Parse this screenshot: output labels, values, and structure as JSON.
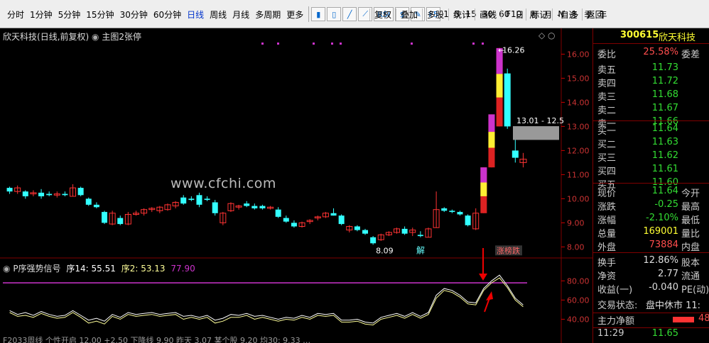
{
  "toolbar": {
    "periods": [
      "分时",
      "1分钟",
      "5分钟",
      "15分钟",
      "30分钟",
      "60分钟",
      "日线",
      "周线",
      "月线",
      "多周期",
      "更多"
    ],
    "active_period": "日线",
    "icons": [
      "kline-icon",
      "bar-icon",
      "line-icon",
      "trend-icon",
      "chart-icon",
      "pencil-icon",
      "f5-icon",
      "refresh-icon"
    ],
    "icon_glyphs": [
      "▮",
      "▯",
      "╱",
      "⟋",
      "RSI",
      "$",
      "✎",
      "F5"
    ],
    "period_numbers": [
      "1",
      "5",
      "15",
      "30",
      "60"
    ],
    "period_words": [
      "日",
      "周",
      "月",
      "N",
      "多",
      "季",
      "年"
    ],
    "right_buttons": [
      "复权",
      "叠加",
      "多股",
      "统计",
      "画线",
      "F10",
      "标记",
      "-自选",
      "返回"
    ]
  },
  "chart": {
    "title": "欣天科技",
    "title_paren": "(日线,前复权)",
    "template": "主图2张停",
    "high_label": "16.26",
    "low_label": "8.09",
    "range_label": "13.01 - 12.5",
    "tag_jie": "解",
    "tag_zt": "涨榜跌",
    "watermark": "www.cfchi.com",
    "price_ticks": [
      "16.00",
      "15.00",
      "14.00",
      "13.00",
      "12.00",
      "11.00",
      "10.00",
      "9.00",
      "8.00"
    ],
    "ind_ticks": [
      "80.00",
      "60.00",
      "40.00"
    ],
    "indicator": {
      "name": "P序强势信号",
      "s1_label": "序14: 55.51",
      "s2_label": "序2: 53.13",
      "s3_label": "77.90"
    },
    "bottom_bar": "F2033周线 个性开启 12.00 +2.50 下降线 9.90 昨天 3.07 某个股 9.20 均30: 9.33 …",
    "colors": {
      "up": "#ff3333",
      "down": "#33ffff",
      "ind_line1": "#ffffff",
      "ind_line2": "#ffff99",
      "threshold": "#cc33cc"
    }
  },
  "chart_data": [
    {
      "type": "candlestick",
      "title": "欣天科技 (日线,前复权)",
      "ylim": [
        7.6,
        16.6
      ],
      "candles": [
        {
          "o": 10.45,
          "h": 10.5,
          "l": 10.2,
          "c": 10.3
        },
        {
          "o": 10.3,
          "h": 10.55,
          "l": 10.2,
          "c": 10.45
        },
        {
          "o": 10.3,
          "h": 10.35,
          "l": 10.0,
          "c": 10.1
        },
        {
          "o": 10.2,
          "h": 10.35,
          "l": 10.1,
          "c": 10.25
        },
        {
          "o": 10.25,
          "h": 10.4,
          "l": 10.0,
          "c": 10.1
        },
        {
          "o": 10.2,
          "h": 10.3,
          "l": 10.1,
          "c": 10.15
        },
        {
          "o": 10.15,
          "h": 10.3,
          "l": 10.05,
          "c": 10.2
        },
        {
          "o": 10.2,
          "h": 10.3,
          "l": 10.1,
          "c": 10.15
        },
        {
          "o": 10.1,
          "h": 10.6,
          "l": 10.1,
          "c": 10.45
        },
        {
          "o": 10.45,
          "h": 10.5,
          "l": 10.1,
          "c": 10.15
        },
        {
          "o": 10.0,
          "h": 10.05,
          "l": 9.7,
          "c": 9.75
        },
        {
          "o": 9.75,
          "h": 9.85,
          "l": 9.6,
          "c": 9.65
        },
        {
          "o": 9.45,
          "h": 9.5,
          "l": 8.95,
          "c": 9.0
        },
        {
          "o": 8.95,
          "h": 9.5,
          "l": 8.9,
          "c": 9.4
        },
        {
          "o": 9.2,
          "h": 9.3,
          "l": 8.9,
          "c": 8.95
        },
        {
          "o": 8.95,
          "h": 9.45,
          "l": 8.9,
          "c": 9.35
        },
        {
          "o": 9.35,
          "h": 9.5,
          "l": 9.3,
          "c": 9.4
        },
        {
          "o": 9.4,
          "h": 9.6,
          "l": 9.3,
          "c": 9.55
        },
        {
          "o": 9.55,
          "h": 9.65,
          "l": 9.45,
          "c": 9.6
        },
        {
          "o": 9.5,
          "h": 9.7,
          "l": 9.4,
          "c": 9.65
        },
        {
          "o": 9.55,
          "h": 9.8,
          "l": 9.5,
          "c": 9.75
        },
        {
          "o": 9.7,
          "h": 9.9,
          "l": 9.6,
          "c": 9.85
        },
        {
          "o": 10.05,
          "h": 10.15,
          "l": 9.75,
          "c": 9.8
        },
        {
          "o": 10.0,
          "h": 10.1,
          "l": 9.9,
          "c": 9.95
        },
        {
          "o": 10.15,
          "h": 10.25,
          "l": 9.65,
          "c": 9.75
        },
        {
          "o": 10.0,
          "h": 10.1,
          "l": 9.9,
          "c": 9.95
        },
        {
          "o": 9.85,
          "h": 9.95,
          "l": 9.3,
          "c": 9.4
        },
        {
          "o": 9.0,
          "h": 9.45,
          "l": 8.9,
          "c": 9.4
        },
        {
          "o": 9.5,
          "h": 9.85,
          "l": 9.45,
          "c": 9.8
        },
        {
          "o": 9.65,
          "h": 9.75,
          "l": 9.55,
          "c": 9.7
        },
        {
          "o": 9.8,
          "h": 9.9,
          "l": 9.65,
          "c": 9.7
        },
        {
          "o": 9.7,
          "h": 9.8,
          "l": 9.55,
          "c": 9.6
        },
        {
          "o": 9.7,
          "h": 9.75,
          "l": 9.55,
          "c": 9.6
        },
        {
          "o": 9.6,
          "h": 9.7,
          "l": 9.55,
          "c": 9.65
        },
        {
          "o": 9.55,
          "h": 9.65,
          "l": 9.2,
          "c": 9.25
        },
        {
          "o": 9.2,
          "h": 9.3,
          "l": 9.0,
          "c": 9.05
        },
        {
          "o": 9.0,
          "h": 9.1,
          "l": 8.8,
          "c": 8.85
        },
        {
          "o": 8.85,
          "h": 9.05,
          "l": 8.8,
          "c": 9.0
        },
        {
          "o": 9.05,
          "h": 9.15,
          "l": 8.95,
          "c": 9.1
        },
        {
          "o": 9.2,
          "h": 9.3,
          "l": 9.1,
          "c": 9.25
        },
        {
          "o": 9.25,
          "h": 9.45,
          "l": 9.2,
          "c": 9.4
        },
        {
          "o": 9.4,
          "h": 9.6,
          "l": 9.3,
          "c": 9.3
        },
        {
          "o": 9.3,
          "h": 9.35,
          "l": 8.9,
          "c": 8.95
        },
        {
          "o": 8.7,
          "h": 8.9,
          "l": 8.6,
          "c": 8.85
        },
        {
          "o": 8.85,
          "h": 8.9,
          "l": 8.65,
          "c": 8.7
        },
        {
          "o": 8.7,
          "h": 8.75,
          "l": 8.5,
          "c": 8.55
        },
        {
          "o": 8.4,
          "h": 8.45,
          "l": 8.09,
          "c": 8.15
        },
        {
          "o": 8.3,
          "h": 8.55,
          "l": 8.25,
          "c": 8.5
        },
        {
          "o": 8.5,
          "h": 8.65,
          "l": 8.45,
          "c": 8.6
        },
        {
          "o": 8.6,
          "h": 8.8,
          "l": 8.55,
          "c": 8.75
        },
        {
          "o": 8.75,
          "h": 8.85,
          "l": 8.5,
          "c": 8.55
        },
        {
          "o": 8.6,
          "h": 8.8,
          "l": 8.45,
          "c": 8.7
        },
        {
          "o": 8.5,
          "h": 8.65,
          "l": 8.4,
          "c": 8.45
        },
        {
          "o": 8.4,
          "h": 8.8,
          "l": 8.4,
          "c": 8.75
        },
        {
          "o": 8.8,
          "h": 10.3,
          "l": 8.8,
          "c": 9.55
        },
        {
          "o": 9.6,
          "h": 9.65,
          "l": 9.45,
          "c": 9.5
        },
        {
          "o": 9.5,
          "h": 9.55,
          "l": 9.4,
          "c": 9.45
        },
        {
          "o": 9.45,
          "h": 9.5,
          "l": 9.3,
          "c": 9.35
        },
        {
          "o": 9.3,
          "h": 9.35,
          "l": 8.85,
          "c": 8.9
        },
        {
          "o": 8.75,
          "h": 9.6,
          "l": 8.7,
          "c": 9.4
        },
        {
          "o": 9.4,
          "h": 11.3,
          "l": 9.4,
          "c": 11.3
        },
        {
          "o": 11.3,
          "h": 13.5,
          "l": 11.3,
          "c": 13.5
        },
        {
          "o": 13.0,
          "h": 16.26,
          "l": 13.0,
          "c": 16.25
        },
        {
          "o": 15.2,
          "h": 15.4,
          "l": 12.9,
          "c": 13.0
        },
        {
          "o": 12.0,
          "h": 12.6,
          "l": 11.5,
          "c": 11.7
        },
        {
          "o": 11.5,
          "h": 11.9,
          "l": 11.3,
          "c": 11.64
        }
      ]
    },
    {
      "type": "line",
      "title": "P序强势信号",
      "ylim": [
        30,
        95
      ],
      "threshold": 77.9,
      "series": [
        {
          "name": "序14",
          "values": [
            49,
            45,
            47,
            44,
            48,
            45,
            43,
            44,
            49,
            44,
            39,
            41,
            38,
            45,
            42,
            47,
            45,
            46,
            47,
            45,
            46,
            47,
            43,
            44,
            42,
            44,
            39,
            41,
            45,
            44,
            46,
            43,
            44,
            42,
            40,
            42,
            41,
            44,
            42,
            46,
            45,
            46,
            39,
            39,
            40,
            37,
            36,
            42,
            44,
            46,
            43,
            47,
            43,
            47,
            65,
            72,
            70,
            65,
            58,
            57,
            72,
            80,
            86,
            75,
            62,
            55
          ]
        },
        {
          "name": "序2",
          "values": [
            47,
            43,
            44,
            42,
            46,
            43,
            41,
            42,
            47,
            42,
            36,
            38,
            35,
            43,
            40,
            45,
            43,
            44,
            45,
            43,
            44,
            45,
            40,
            42,
            40,
            42,
            36,
            38,
            42,
            42,
            44,
            40,
            42,
            40,
            38,
            40,
            39,
            42,
            40,
            44,
            43,
            44,
            37,
            37,
            38,
            35,
            34,
            40,
            42,
            44,
            41,
            45,
            41,
            45,
            62,
            70,
            68,
            63,
            56,
            55,
            70,
            78,
            83,
            73,
            60,
            53
          ]
        }
      ]
    }
  ],
  "side": {
    "code": "300615",
    "name": "欣天科技",
    "webi_label": "委比",
    "webi_value": "25.58%",
    "wecha_label": "委差",
    "sells": [
      {
        "label": "卖五",
        "price": "11.73"
      },
      {
        "label": "卖四",
        "price": "11.72"
      },
      {
        "label": "卖三",
        "price": "11.68"
      },
      {
        "label": "卖二",
        "price": "11.67"
      },
      {
        "label": "卖一",
        "price": "11.66"
      }
    ],
    "buys": [
      {
        "label": "买一",
        "price": "11.64"
      },
      {
        "label": "买二",
        "price": "11.63"
      },
      {
        "label": "买三",
        "price": "11.62"
      },
      {
        "label": "买四",
        "price": "11.61"
      },
      {
        "label": "买五",
        "price": "11.60"
      }
    ],
    "stats": [
      {
        "label": "现价",
        "value": "11.64",
        "r": "今开",
        "cls": "dn"
      },
      {
        "label": "涨跌",
        "value": "-0.25",
        "r": "最高",
        "cls": "dn"
      },
      {
        "label": "涨幅",
        "value": "-2.10%",
        "r": "最低",
        "cls": "dn"
      },
      {
        "label": "总量",
        "value": "169001",
        "r": "量比",
        "cls": "yl"
      },
      {
        "label": "外盘",
        "value": "73884",
        "r": "内盘",
        "cls": "up"
      }
    ],
    "stats2": [
      {
        "label": "换手",
        "value": "12.86%",
        "r": "股本"
      },
      {
        "label": "净资",
        "value": "2.77",
        "r": "流通"
      },
      {
        "label": "收益(一)",
        "value": "-0.040",
        "r": "PE(动)"
      }
    ],
    "status_label": "交易状态:",
    "status_value": "盘中休市 11:",
    "main_flow_label": "主力净额",
    "main_flow_value": "48",
    "last_time": "11:29",
    "last_price": "11.65"
  }
}
